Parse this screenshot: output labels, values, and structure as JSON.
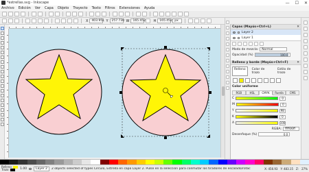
{
  "window": {
    "title": "*estrellas.svg - Inkscape",
    "controls": [
      "—",
      "☐",
      "✕"
    ]
  },
  "menu": [
    "Archivo",
    "Edición",
    "Ver",
    "Capa",
    "Objeto",
    "Trayecto",
    "Texto",
    "Filtros",
    "Extensiones",
    "Ayuda"
  ],
  "toolctl": {
    "x_label": "X",
    "x": "403.951",
    "y_label": "Y",
    "y": "257.730",
    "w_label": "W",
    "w": "165.452",
    "h_label": "H",
    "h": "165.452",
    "unit": "px"
  },
  "layers_panel": {
    "title": "Capas (Mayús+Ctrl+L)",
    "layers": [
      {
        "name": "Layer 2",
        "selected": true
      },
      {
        "name": "Layer 1",
        "selected": false
      }
    ],
    "blend_label": "Modo de mezcla:",
    "blend_value": "Normal",
    "opacity_label": "Opacidad (%)",
    "opacity_value": "100.0"
  },
  "fill_panel": {
    "title": "Relleno y borde (Mayús+Ctrl+F)",
    "tabs": [
      "Relleno",
      "Color de trazo",
      "Estilo de trazo"
    ],
    "active_tab": "Relleno",
    "section_label": "Color uniforme",
    "modes": [
      "RGB",
      "HSL",
      "CMYK",
      "Rueda",
      "CMS"
    ],
    "active_mode": "CMYK",
    "sliders": [
      {
        "label": "C",
        "value": "0"
      },
      {
        "label": "M",
        "value": "0"
      },
      {
        "label": "Y",
        "value": "98"
      },
      {
        "label": "K",
        "value": "0"
      },
      {
        "label": "A",
        "value": "100"
      }
    ],
    "rgba_label": "RGBA:",
    "rgba_value": "ffff06ff",
    "blur_label": "Desenfoque (%)",
    "blur_value": "0.0"
  },
  "colors": {
    "circle": "#f9cfd2",
    "star": "#fff506",
    "canvas": "#c7e4ef"
  },
  "palette": [
    "#000000",
    "#1a1a1a",
    "#333333",
    "#4d4d4d",
    "#666666",
    "#808080",
    "#999999",
    "#b3b3b3",
    "#cccccc",
    "#e6e6e6",
    "#ffffff",
    "#800000",
    "#ff0000",
    "#ff6600",
    "#ff9900",
    "#ffcc00",
    "#ffff00",
    "#ccff00",
    "#66ff00",
    "#00ff00",
    "#00ff66",
    "#00ffcc",
    "#00ccff",
    "#0066ff",
    "#0000ff",
    "#6600ff",
    "#cc00ff",
    "#ff00cc",
    "#ff0066",
    "#803300",
    "#996633",
    "#ccaa77",
    "#ffe0c0",
    "#e0f0ff"
  ],
  "status": {
    "fill_label": "Relleno:",
    "stroke_label": "Trazo:",
    "stroke_width": "1.00",
    "layer": "Layer 2",
    "message": "2 objects selected of types Círculo, Estrella en capa Layer 2. Pulse en la selección para conmutar los tiradores de escalado/rotación.",
    "coords_x": "X: 456.93",
    "coords_y": "Y: 483.15",
    "zoom_label": "Z:",
    "zoom_value": "27%"
  }
}
